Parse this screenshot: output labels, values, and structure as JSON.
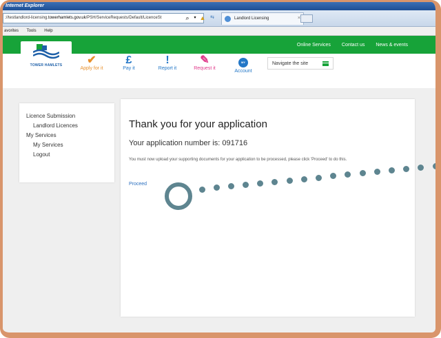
{
  "browser": {
    "title": "Internet Explorer",
    "address_prefix": "://testlandlord-licensing.",
    "address_domain": "towerhamlets.gov.uk",
    "address_suffix": "/PSH/ServiceRequests/Default/LicenceSt",
    "tab_title": "Landlord Licensing",
    "tab_close": "×",
    "menu": [
      "avorites",
      "Tools",
      "Help"
    ]
  },
  "site": {
    "top_links": [
      "Online Services",
      "Contact us",
      "News & events"
    ],
    "logo_text": "TOWER HAMLETS",
    "nav": [
      {
        "label": "Apply for it",
        "icon": "✔"
      },
      {
        "label": "Pay it",
        "icon": "£"
      },
      {
        "label": "Report it",
        "icon": "!"
      },
      {
        "label": "Request it",
        "icon": "✎"
      },
      {
        "label": "Account",
        "icon": "MY"
      }
    ],
    "navigate_label": "Navigate the site"
  },
  "sidebar": {
    "items": [
      {
        "label": "Licence Submission"
      },
      {
        "label": "Landlord Licences"
      },
      {
        "label": "My Services"
      },
      {
        "label": "My Services"
      },
      {
        "label": "Logout"
      }
    ]
  },
  "main": {
    "heading": "Thank you for your application",
    "app_number_label": "Your application number is:",
    "app_number": "091716",
    "message": "You must now upload your supporting documents for your application to be processed, please click 'Proceed' to do this.",
    "proceed_label": "Proceed"
  },
  "colors": {
    "frame": "#d9956b",
    "green": "#17a339",
    "callout": "#5e8590"
  }
}
